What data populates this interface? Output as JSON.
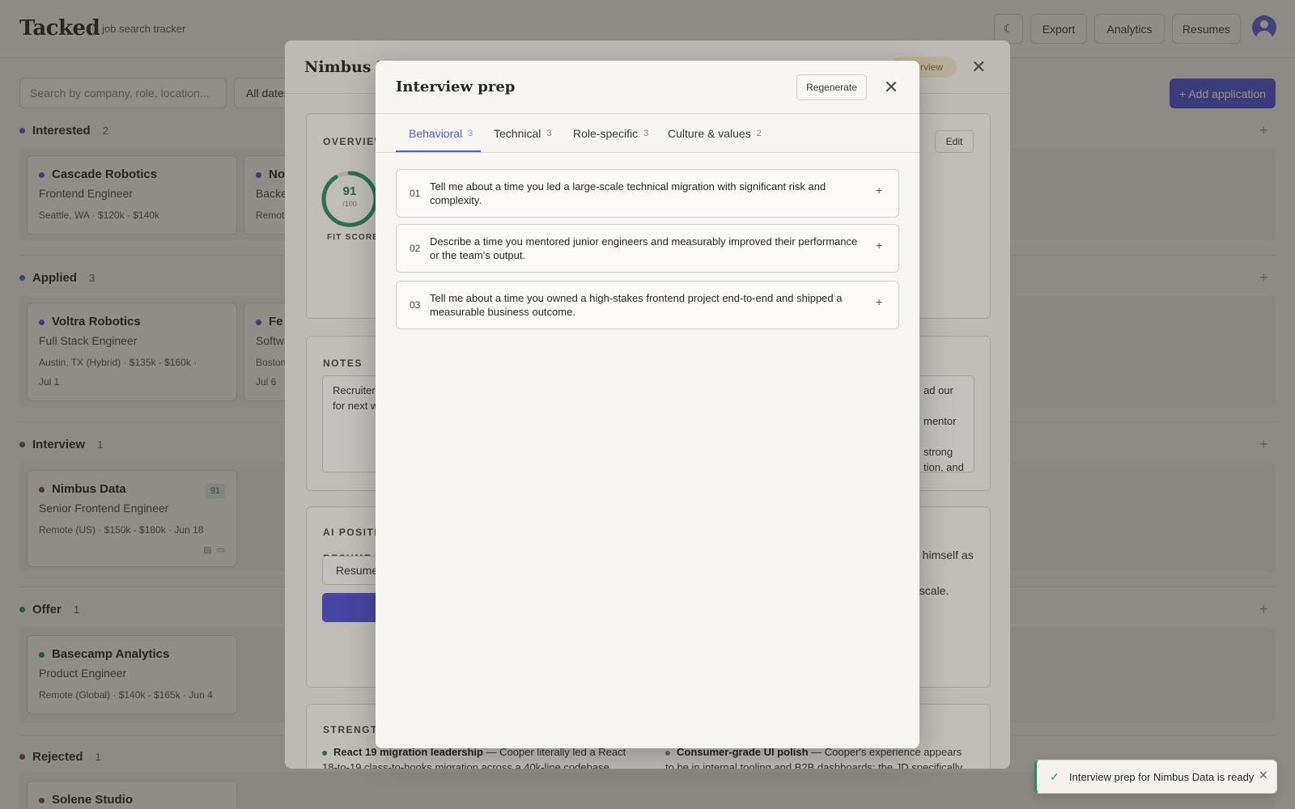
{
  "app": {
    "brand": "Tacked",
    "tagline": "job search tracker",
    "theme_icon": "moon-icon",
    "nav": {
      "export": "Export",
      "analytics": "Analytics",
      "resumes": "Resumes"
    },
    "search_placeholder": "Search by company, role, location...",
    "date_filter": "All dates",
    "add_application": "+ Add application",
    "accent_color": "#4f52d4"
  },
  "stages": [
    {
      "name": "Interested",
      "count": "2",
      "color": "#5458d4"
    },
    {
      "name": "Applied",
      "count": "3",
      "color": "#5458d4"
    },
    {
      "name": "Interview",
      "count": "1",
      "color": "#7a4a3a"
    },
    {
      "name": "Offer",
      "count": "1",
      "color": "#2f8a66"
    },
    {
      "name": "Rejected",
      "count": "1",
      "color": "#7a4a3a"
    }
  ],
  "cards": {
    "cascade": {
      "company": "Cascade Robotics",
      "role": "Frontend Engineer",
      "meta": "Seattle, WA  ·  $120k - $140k"
    },
    "interested_2": {
      "company": "No",
      "role": "Backen",
      "meta": "Remote"
    },
    "voltra": {
      "company": "Voltra Robotics",
      "role": "Full Stack Engineer",
      "meta": "Austin, TX (Hybrid)  ·  $135k - $160k  ·",
      "meta2": "Jul 1"
    },
    "applied_2": {
      "company": "Fe",
      "role": "Softwa",
      "meta": "Boston",
      "meta2": "Jul 6"
    },
    "nimbus": {
      "company": "Nimbus Data",
      "role": "Senior Frontend Engineer",
      "meta": "Remote (US)  ·  $150k - $180k  ·  Jun 18",
      "score": "91"
    },
    "basecamp": {
      "company": "Basecamp Analytics",
      "role": "Product Engineer",
      "meta": "Remote (Global)  ·  $140k - $165k  ·  Jun 4"
    },
    "solene": {
      "company": "Solene Studio"
    }
  },
  "detail": {
    "title": "Nimbus Da",
    "stage_pill": "Interview",
    "overview_label": "OVERVIEW",
    "edit": "Edit",
    "fit_score": 91,
    "fit_score_text": "91",
    "fit_score_max": "/100",
    "fit_label": "FIT SCORE",
    "notes_label": "NOTES",
    "notes_left": "Recruiter\nfor next w",
    "notes_right": "ad our\n\nmentor\n\nstrong\ntion, and",
    "ai_label": "AI POSITIO",
    "resume_label": "RESUME",
    "resume_select": "Resume",
    "ai_right": "e himself as\nl\nt scale.",
    "strengths_label": "STRENGTH",
    "strength_left_title": "React 19 migration leadership",
    "strength_left_body": " — Cooper literally led a React 18-to-19 class-to-hooks migration across a 40k-line codebase",
    "strength_right_title": "Consumer-grade UI polish",
    "strength_right_body": " — Cooper's experience appears to be in internal tooling and B2B dashboards; the JD specifically"
  },
  "prep": {
    "title": "Interview prep",
    "regenerate": "Regenerate",
    "tabs": [
      {
        "label": "Behavioral",
        "count": "3"
      },
      {
        "label": "Technical",
        "count": "3"
      },
      {
        "label": "Role-specific",
        "count": "3"
      },
      {
        "label": "Culture & values",
        "count": "2"
      }
    ],
    "questions": [
      {
        "num": "01",
        "text": "Tell me about a time you led a large-scale technical migration with significant risk and complexity."
      },
      {
        "num": "02",
        "text": "Describe a time you mentored junior engineers and measurably improved their performance or the team's output."
      },
      {
        "num": "03",
        "text": "Tell me about a time you owned a high-stakes frontend project end-to-end and shipped a measurable business outcome."
      }
    ]
  },
  "toast": {
    "text": "Interview prep for Nimbus Data is ready",
    "icon": "check-icon"
  }
}
